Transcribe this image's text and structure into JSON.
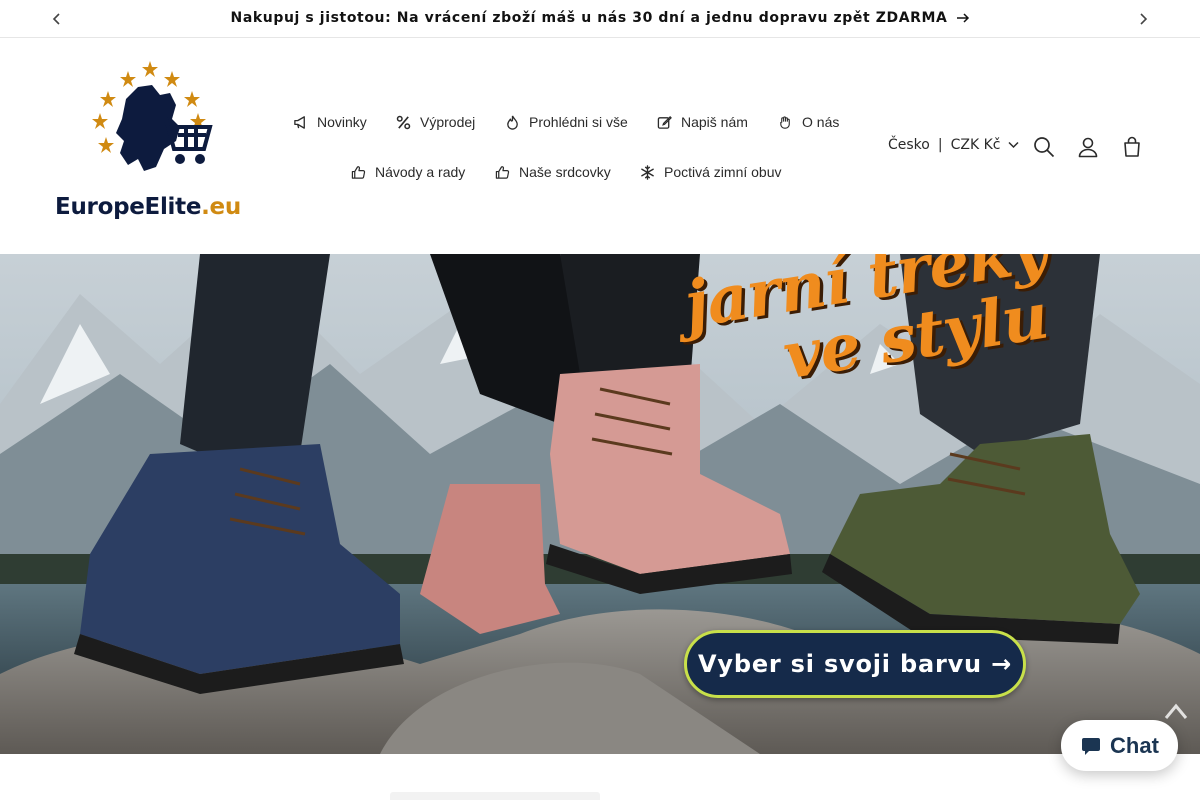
{
  "announcement": {
    "text": "Nakupuj s jistotou: Na vrácení zboží máš u nás 30 dní a jednu dopravu zpět ZDARMA",
    "prev_icon": "chevron-left-icon",
    "next_icon": "chevron-right-icon",
    "link_icon": "arrow-right-icon"
  },
  "header": {
    "logo_text_main": "EuropeElite",
    "logo_text_tld": ".eu",
    "nav": [
      {
        "label": "Novinky",
        "icon": "megaphone-icon"
      },
      {
        "label": "Výprodej",
        "icon": "percent-icon"
      },
      {
        "label": "Prohlédni si vše",
        "icon": "flame-icon"
      },
      {
        "label": "Napiš nám",
        "icon": "edit-icon"
      },
      {
        "label": "O nás",
        "icon": "hand-icon"
      },
      {
        "label": "Návody a rady",
        "icon": "thumbs-up-icon"
      },
      {
        "label": "Naše srdcovky",
        "icon": "thumbs-up-icon"
      },
      {
        "label": "Poctivá zimní obuv",
        "icon": "snowflake-icon"
      }
    ],
    "locale": {
      "country": "Česko",
      "separator": "|",
      "currency": "CZK Kč"
    },
    "icons": [
      "search-icon",
      "account-icon",
      "cart-icon"
    ]
  },
  "hero": {
    "title_line1": "jarní treky",
    "title_line2": "ve stylu",
    "cta_label": "Vyber si svoji barvu →"
  },
  "chat": {
    "label": "Chat",
    "icon": "chat-bubble-icon"
  },
  "colors": {
    "accent_orange": "#f08c1e",
    "cta_navy": "#152a4a",
    "cta_border": "#c8e04a",
    "logo_navy": "#0d1b3e",
    "logo_gold": "#d08a12",
    "chat_navy": "#1b3552"
  }
}
